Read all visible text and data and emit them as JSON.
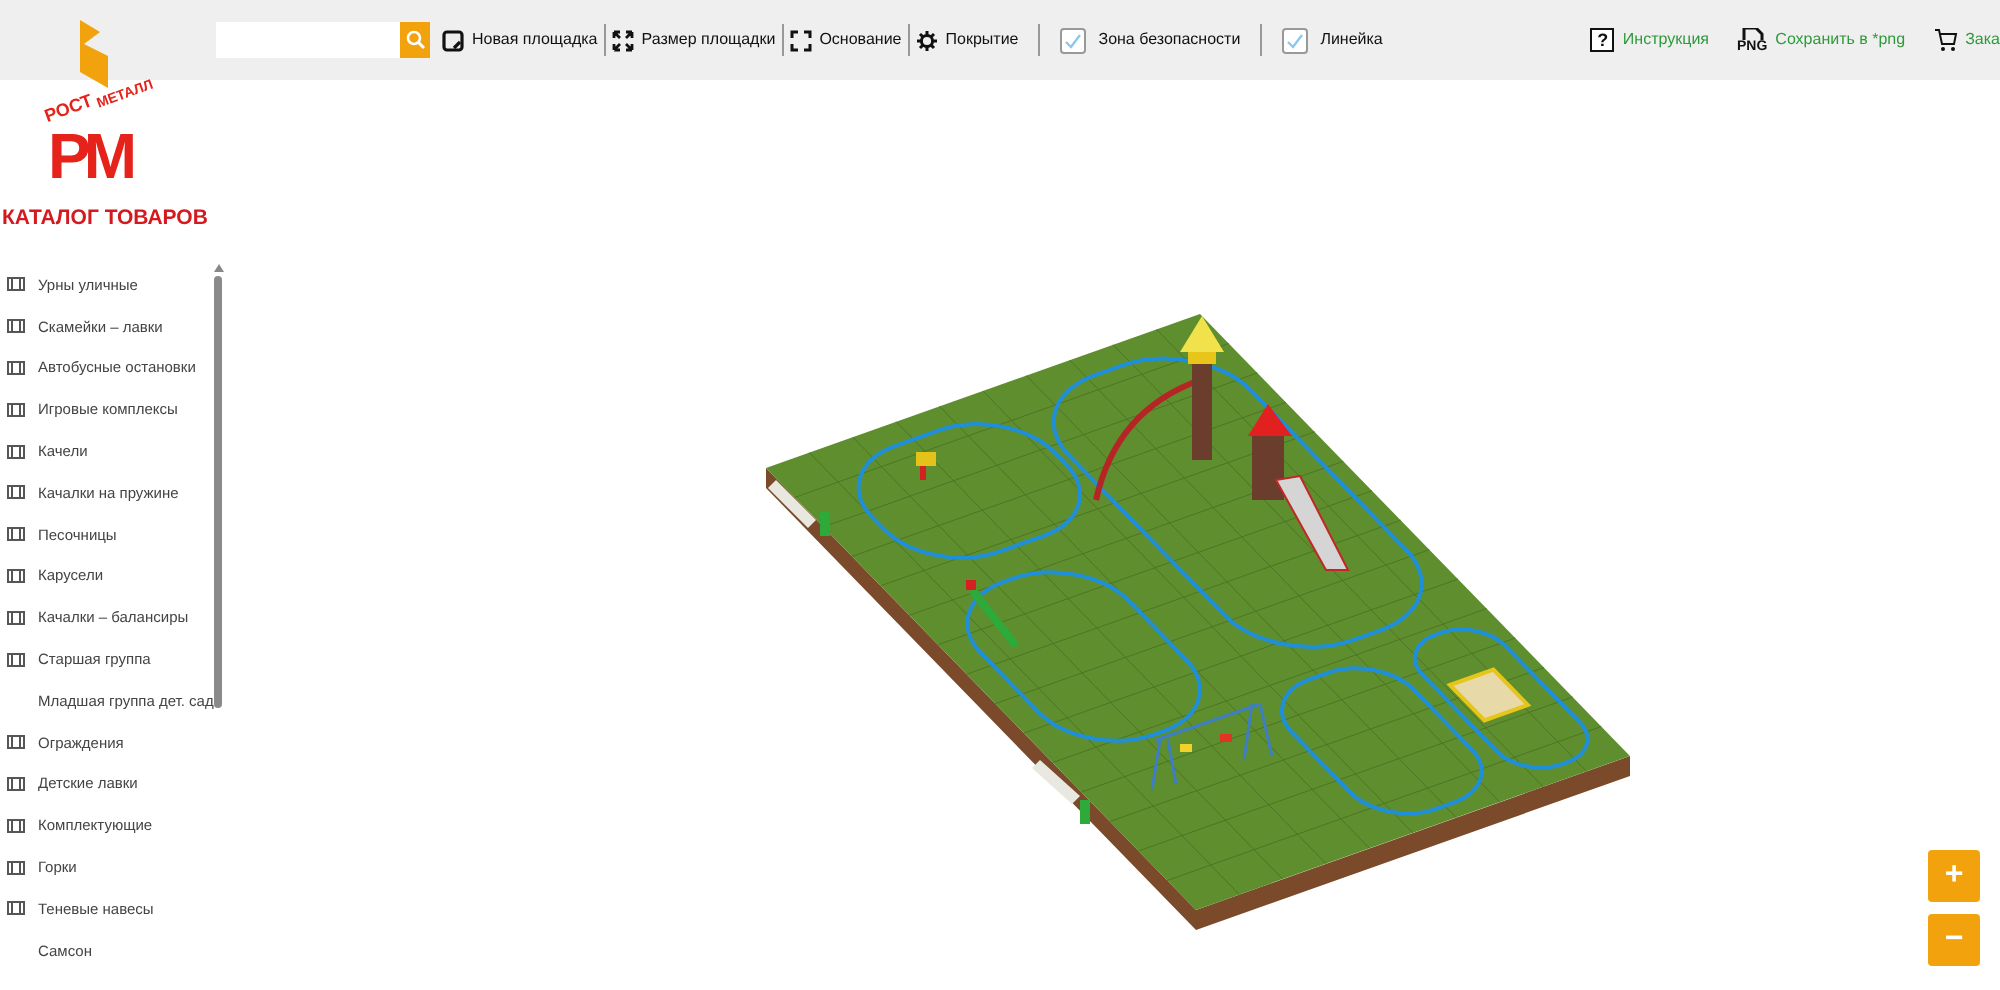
{
  "logo": {
    "top_left": "РОСТ",
    "top_right": "МЕТАЛЛ",
    "letters": "РМ"
  },
  "catalog_title": "КАТАЛОГ ТОВАРОВ",
  "tools": [
    {
      "kind": "button",
      "label": "Новая площадка"
    },
    {
      "kind": "button",
      "label": "Размер площадки"
    },
    {
      "kind": "button",
      "label": "Основание"
    },
    {
      "kind": "button",
      "label": "Покрытие"
    },
    {
      "kind": "checkbox",
      "label": "Зона безопасности",
      "checked": true
    },
    {
      "kind": "checkbox",
      "label": "Линейка",
      "checked": true
    }
  ],
  "links": [
    {
      "kind": "help",
      "label": "Инструкция",
      "badge": "?"
    },
    {
      "kind": "png",
      "label": "Сохранить в *png",
      "badge": "PNG"
    },
    {
      "kind": "cart",
      "label": "Зака"
    }
  ],
  "categories": [
    {
      "label": "Урны уличные",
      "icon": true
    },
    {
      "label": "Скамейки – лавки",
      "icon": true
    },
    {
      "label": "Автобусные остановки",
      "icon": true
    },
    {
      "label": "Игровые комплексы",
      "icon": true
    },
    {
      "label": "Качели",
      "icon": true
    },
    {
      "label": "Качалки на пружине",
      "icon": true
    },
    {
      "label": "Песочницы",
      "icon": true
    },
    {
      "label": "Карусели",
      "icon": true
    },
    {
      "label": "Качалки – балансиры",
      "icon": true
    },
    {
      "label": "Старшая группа",
      "icon": true
    },
    {
      "label": "Младшая группа дет. сад",
      "icon": false
    },
    {
      "label": "Ограждения",
      "icon": true
    },
    {
      "label": "Детские лавки",
      "icon": true
    },
    {
      "label": "Комплектующие",
      "icon": true
    },
    {
      "label": "Горки",
      "icon": true
    },
    {
      "label": "Теневые навесы",
      "icon": true
    },
    {
      "label": "Самсон",
      "icon": false
    }
  ],
  "zoom_buttons": [
    "+",
    "−"
  ]
}
